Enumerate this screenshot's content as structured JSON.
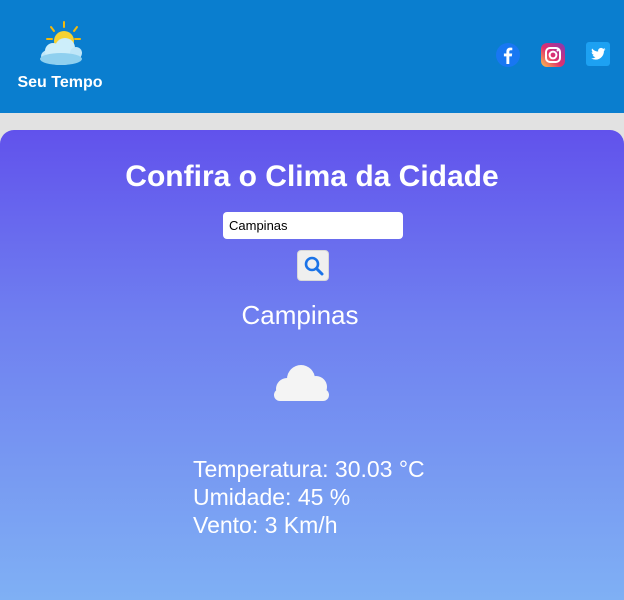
{
  "brand": {
    "name": "Seu Tempo",
    "logo_icon": "sun-cloud-icon"
  },
  "social": [
    {
      "name": "facebook",
      "icon": "facebook-icon",
      "color": "#1877f2"
    },
    {
      "name": "instagram",
      "icon": "instagram-icon",
      "color": "#e1306c"
    },
    {
      "name": "twitter",
      "icon": "twitter-icon",
      "color": "#1da1f2"
    }
  ],
  "main": {
    "title": "Confira o Clima da Cidade",
    "search": {
      "value": "Campinas",
      "button_icon": "search-icon"
    },
    "city": "Campinas",
    "weather_icon": "cloud-icon",
    "temperature": "Temperatura: 30.03 °C",
    "humidity": "Umidade: 45 %",
    "wind": "Vento: 3 Km/h"
  },
  "colors": {
    "header": "#0a7ecf",
    "gradient_top": "#6152ec",
    "gradient_bottom": "#7fb0f4"
  }
}
